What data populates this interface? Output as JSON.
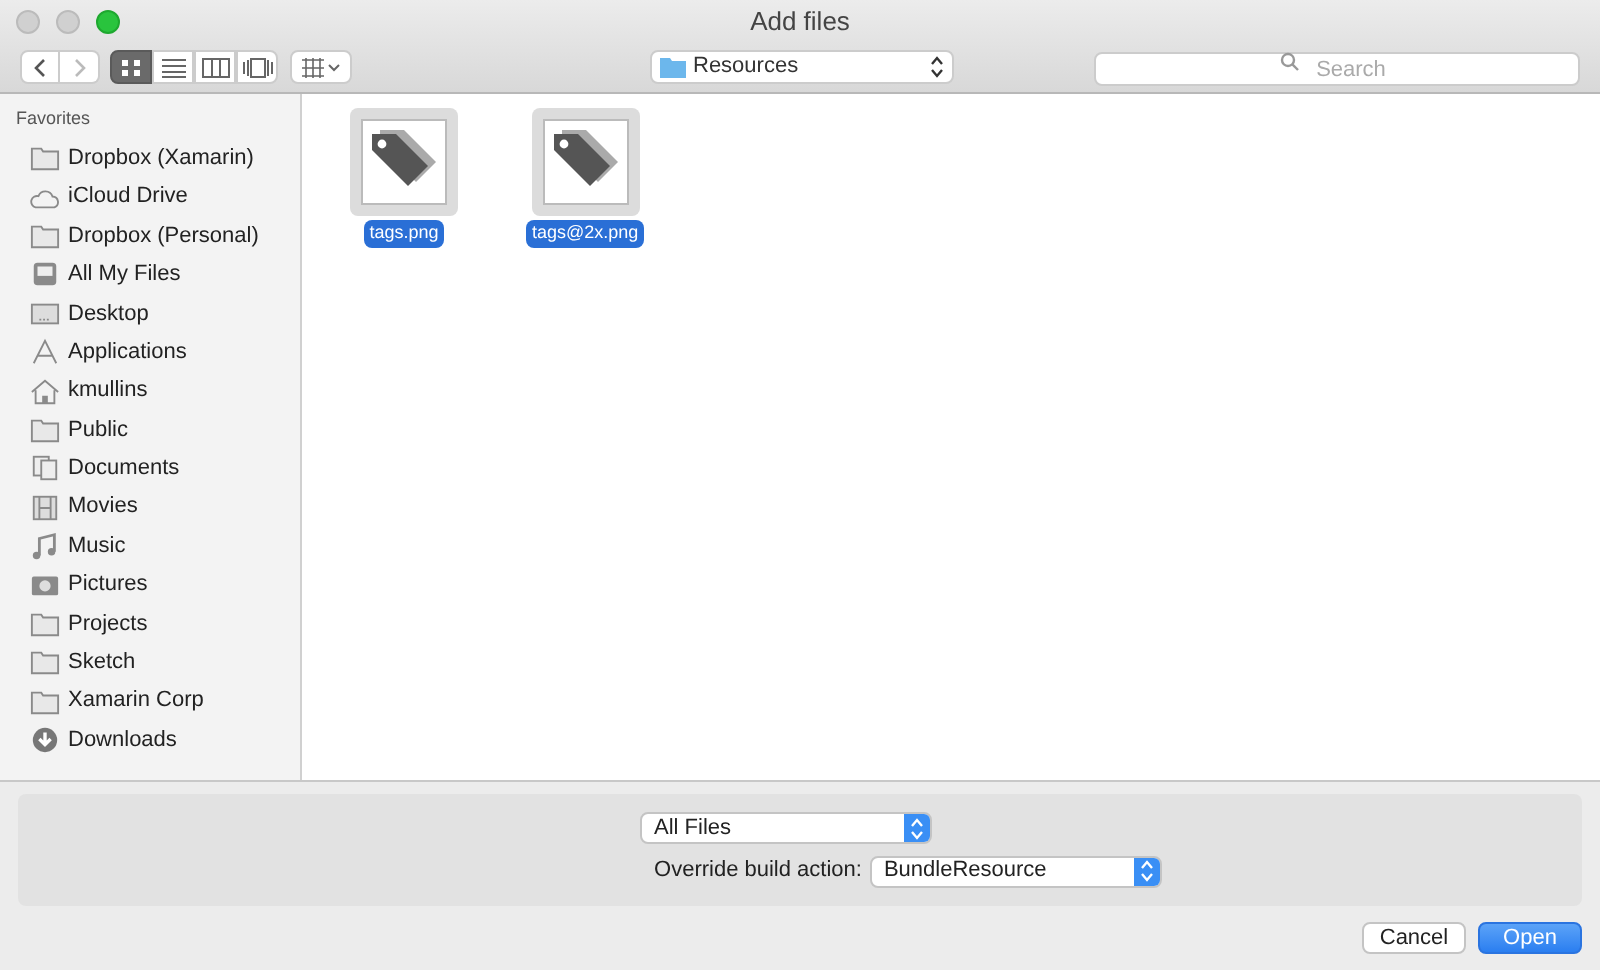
{
  "window": {
    "title": "Add files"
  },
  "toolbar": {
    "view_modes": [
      {
        "kind": "icons",
        "selected": true
      },
      {
        "kind": "list",
        "selected": false
      },
      {
        "kind": "columns",
        "selected": false
      },
      {
        "kind": "coverflow",
        "selected": false
      }
    ],
    "location": "Resources",
    "search": {
      "placeholder": "Search"
    }
  },
  "sidebar": {
    "section": "Favorites",
    "items": [
      {
        "label": "Dropbox (Xamarin)",
        "kind": "folder"
      },
      {
        "label": "iCloud Drive",
        "kind": "cloud"
      },
      {
        "label": "Dropbox (Personal)",
        "kind": "folder"
      },
      {
        "label": "All My Files",
        "kind": "allfiles"
      },
      {
        "label": "Desktop",
        "kind": "desktop"
      },
      {
        "label": "Applications",
        "kind": "apps"
      },
      {
        "label": "kmullins",
        "kind": "home"
      },
      {
        "label": "Public",
        "kind": "folder"
      },
      {
        "label": "Documents",
        "kind": "documents"
      },
      {
        "label": "Movies",
        "kind": "movies"
      },
      {
        "label": "Music",
        "kind": "music"
      },
      {
        "label": "Pictures",
        "kind": "pictures"
      },
      {
        "label": "Projects",
        "kind": "folder"
      },
      {
        "label": "Sketch",
        "kind": "folder"
      },
      {
        "label": "Xamarin Corp",
        "kind": "folder"
      },
      {
        "label": "Downloads",
        "kind": "downloads"
      }
    ]
  },
  "files": [
    {
      "name": "tags.png",
      "selected": true
    },
    {
      "name": "tags@2x.png",
      "selected": true
    }
  ],
  "options": {
    "filter": "All Files",
    "build_action_label": "Override build action:",
    "build_action": "BundleResource"
  },
  "buttons": [
    {
      "label": "Cancel",
      "kind": "secondary"
    },
    {
      "label": "Open",
      "kind": "primary"
    }
  ]
}
